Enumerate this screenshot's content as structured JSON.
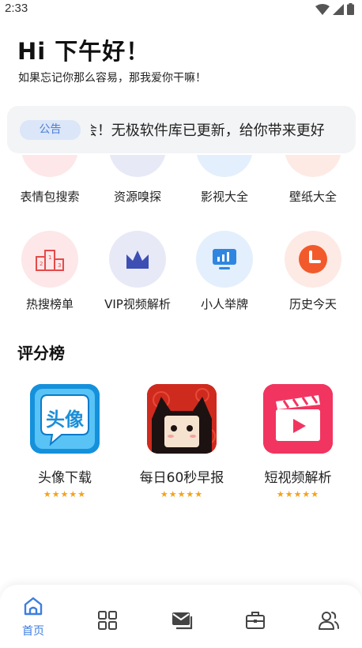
{
  "status": {
    "time": "2:33"
  },
  "greeting": {
    "title": "Hi 下午好！",
    "subtitle": "如果忘记你那么容易，那我爱你干嘛！"
  },
  "notice": {
    "badge": "公告",
    "text_head": "会！",
    "text": "无极软件库已更新，给你带来更好"
  },
  "tools_row1": [
    {
      "label": "表情包搜索",
      "color": "#fde7e8"
    },
    {
      "label": "资源嗅探",
      "color": "#e7e9f7"
    },
    {
      "label": "影视大全",
      "color": "#e3effc"
    },
    {
      "label": "壁纸大全",
      "color": "#fdeae4"
    }
  ],
  "tools_row2": [
    {
      "label": "热搜榜单",
      "icon": "podium-icon",
      "color": "#fde7e8"
    },
    {
      "label": "VIP视频解析",
      "icon": "crown-icon",
      "color": "#e7e9f7"
    },
    {
      "label": "小人举牌",
      "icon": "signboard-icon",
      "color": "#e3effc"
    },
    {
      "label": "历史今天",
      "icon": "clock-icon",
      "color": "#fdeae4"
    }
  ],
  "section": {
    "title": "评分榜"
  },
  "apps": [
    {
      "name": "头像下载",
      "stars": "★★★★★"
    },
    {
      "name": "每日60秒早报",
      "stars": "★★★★★"
    },
    {
      "name": "短视频解析",
      "stars": "★★★★★"
    }
  ],
  "app_icon_text": {
    "avatar": "头像"
  },
  "nav": {
    "home_label": "首页",
    "accent": "#3d7ee0"
  }
}
